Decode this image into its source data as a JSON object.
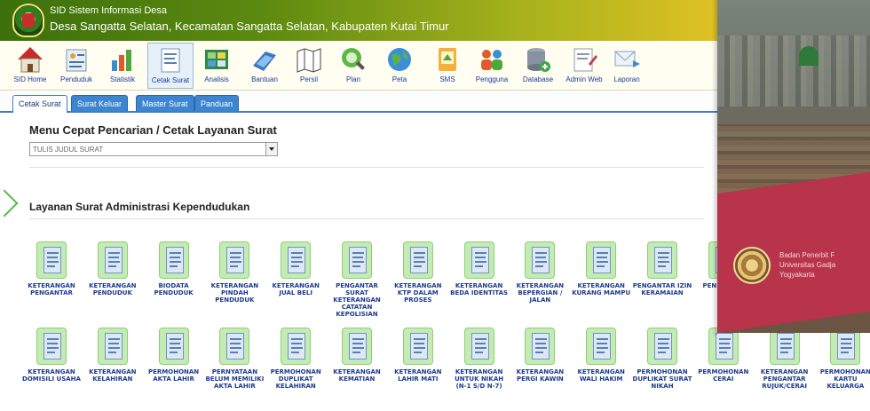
{
  "header": {
    "app_name": "SID Sistem Informasi Desa",
    "village": "Desa Sangatta Selatan, Kecamatan Sangatta Selatan, Kabupaten Kutai Timur"
  },
  "toolbar": [
    {
      "label": "SID Home",
      "icon": "home-icon"
    },
    {
      "label": "Penduduk",
      "icon": "people-icon"
    },
    {
      "label": "Statistik",
      "icon": "statistics-icon"
    },
    {
      "label": "Cetak Surat",
      "icon": "print-letter-icon",
      "active": true
    },
    {
      "label": "Analisis",
      "icon": "analysis-icon"
    },
    {
      "label": "Bantuan",
      "icon": "help-icon"
    },
    {
      "label": "Persil",
      "icon": "map-parcel-icon"
    },
    {
      "label": "Plan",
      "icon": "plan-icon"
    },
    {
      "label": "Peta",
      "icon": "globe-icon"
    },
    {
      "label": "SMS",
      "icon": "sms-icon"
    },
    {
      "label": "Pengguna",
      "icon": "users-icon"
    },
    {
      "label": "Database",
      "icon": "database-icon"
    },
    {
      "label": "Admin Web",
      "icon": "admin-web-icon"
    },
    {
      "label": "Laporan",
      "icon": "report-mail-icon"
    }
  ],
  "tabs": [
    {
      "label": "Cetak Surat",
      "active": true
    },
    {
      "label": "Surat Keluar"
    },
    {
      "label": "Master Surat"
    },
    {
      "label": "Panduan"
    }
  ],
  "search": {
    "title": "Menu Cepat Pencarian / Cetak Layanan Surat",
    "placeholder": "TULIS JUDUL SURAT"
  },
  "section": {
    "title": "Layanan Surat Administrasi Kependudukan"
  },
  "letters_row1": [
    "KETERANGAN PENGANTAR",
    "KETERANGAN PENDUDUK",
    "BIODATA PENDUDUK",
    "KETERANGAN PINDAH PENDUDUK",
    "KETERANGAN JUAL BELI",
    "PENGANTAR SURAT KETERANGAN CATATAN KEPOLISIAN",
    "KETERANGAN KTP DALAM PROSES",
    "KETERANGAN BEDA IDENTITAS",
    "KETERANGAN BEPERGIAN / JALAN",
    "KETERANGAN KURANG MAMPU",
    "PENGANTAR IZIN KERAMAIAN",
    "PEN LA KEH"
  ],
  "letters_row2": [
    "KETERANGAN DOMISILI USAHA",
    "KETERANGAN KELAHIRAN",
    "PERMOHONAN AKTA LAHIR",
    "PERNYATAAN BELUM MEMILIKI AKTA LAHIR",
    "PERMOHONAN DUPLIKAT KELAHIRAN",
    "KETERANGAN KEMATIAN",
    "KETERANGAN LAHIR MATI",
    "KETERANGAN UNTUK NIKAH (N-1 S/D N-7)",
    "KETERANGAN PERGI KAWIN",
    "KETERANGAN WALI HAKIM",
    "PERMOHONAN DUPLIKAT SURAT NIKAH",
    "PERMOHONAN CERAI",
    "KETERANGAN PENGANTAR RUJUK/CERAI",
    "PERMOHONAN KARTU KELUARGA"
  ],
  "book_overlay": {
    "publisher_line1": "Badan Penerbit F",
    "publisher_line2": "Universitas Gadja",
    "publisher_line3": "Yogyakarta"
  },
  "colors": {
    "header_start": "#3d6f0c",
    "header_end": "#f3c928",
    "tab_blue": "#3d86cf",
    "tile_green": "#c5ebb4",
    "label_blue": "#1d3a8f"
  }
}
